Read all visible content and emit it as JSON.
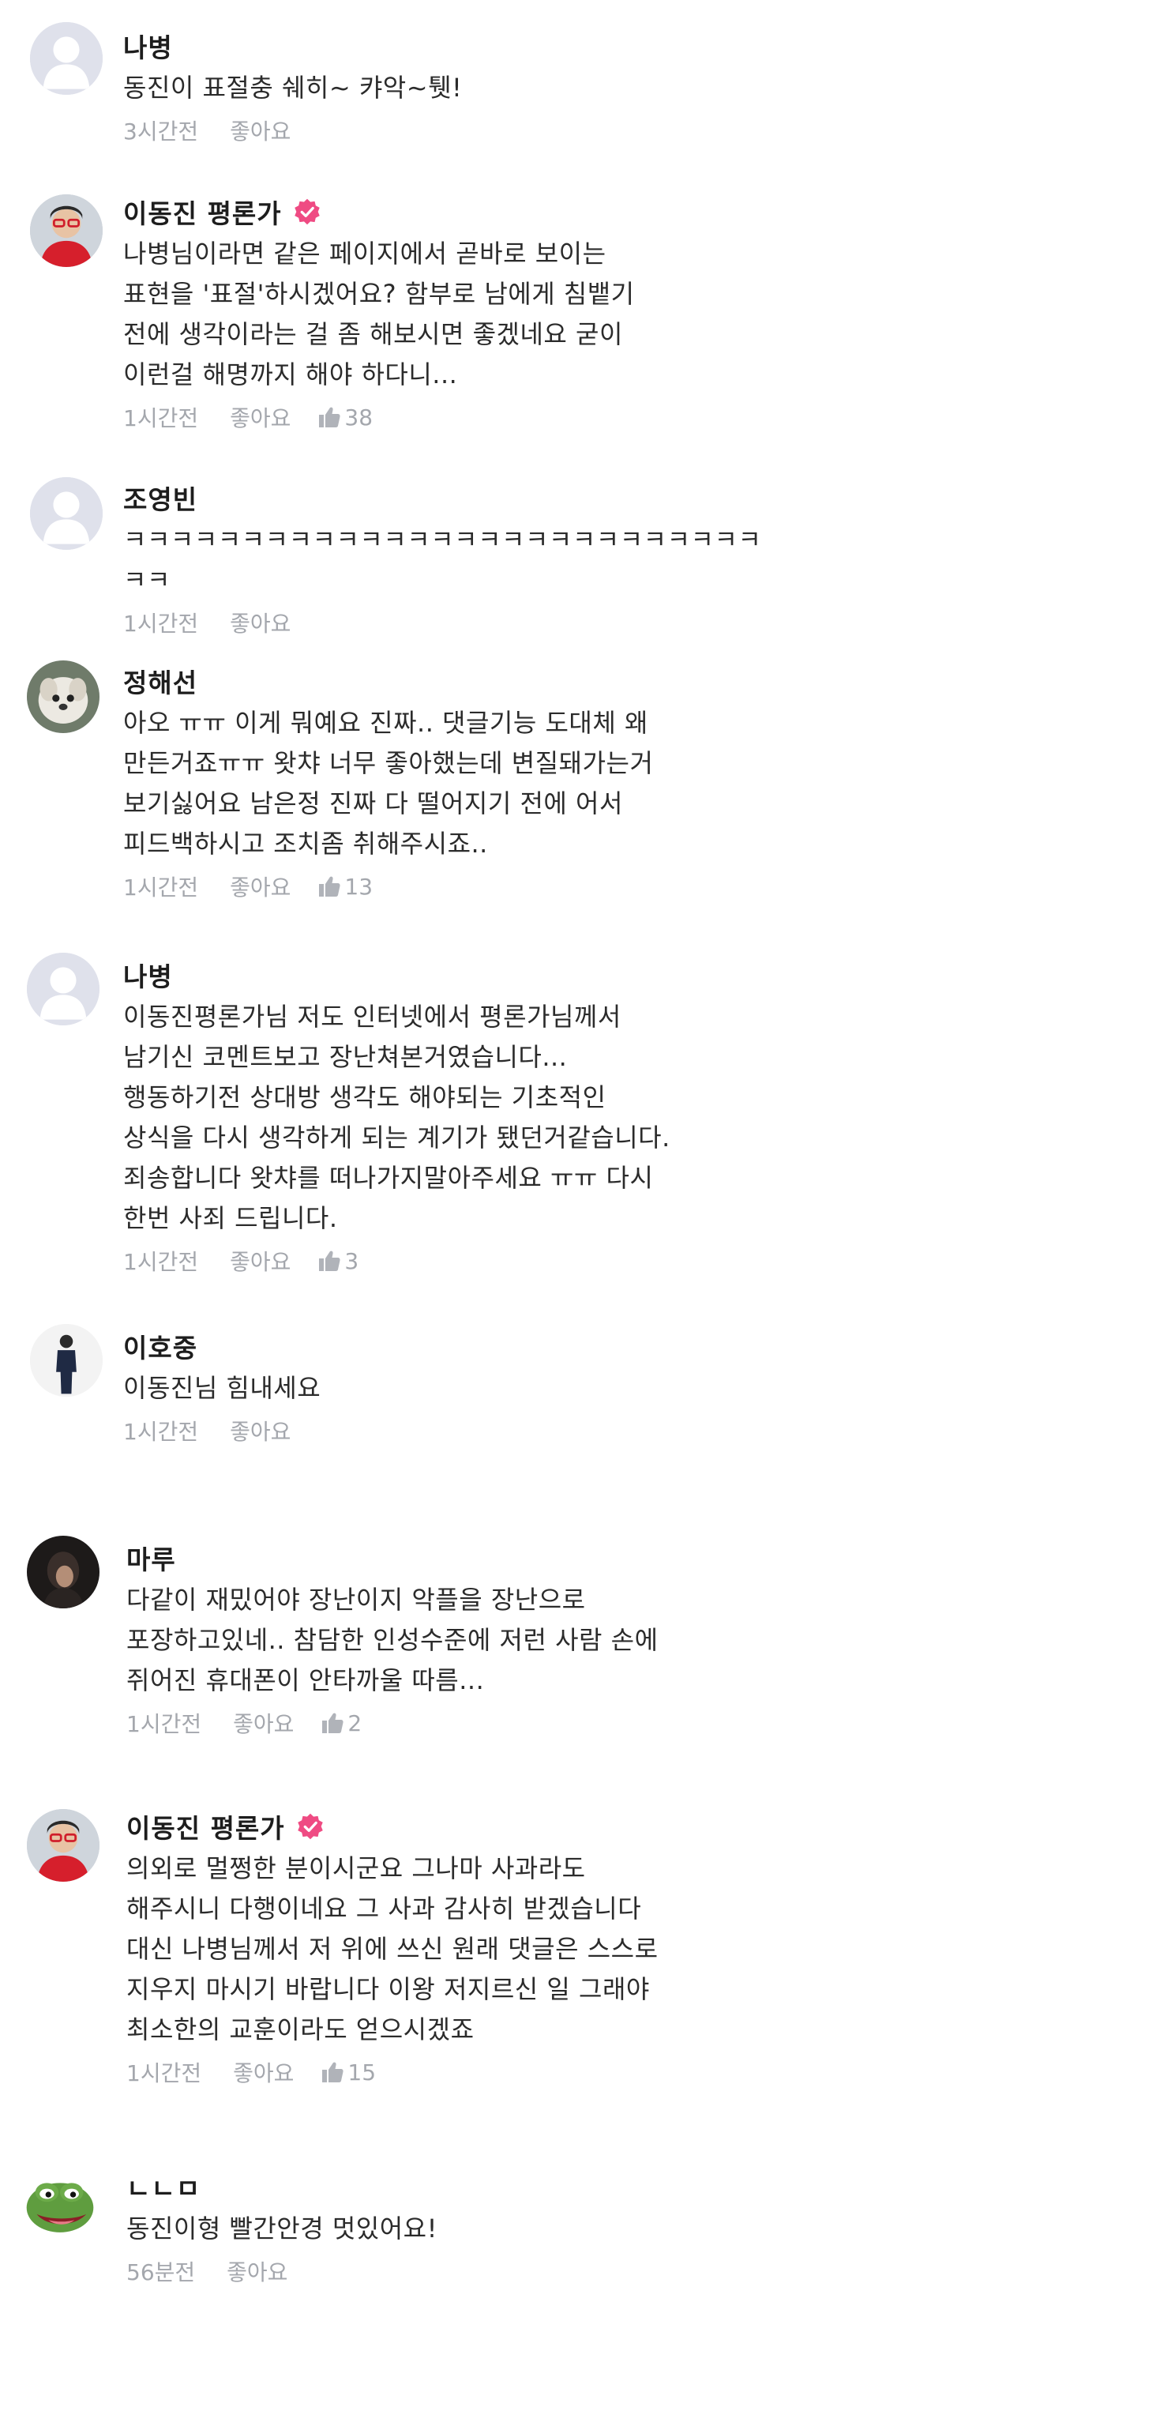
{
  "like_label": "좋아요",
  "comments": [
    {
      "author": "나병",
      "text": "동진이 표절충 쉐히~ 캬악~퉷!",
      "time": "3시간전",
      "likes": ""
    },
    {
      "author": "이동진 평론가",
      "text": "나병님이라면 같은 페이지에서 곧바로 보이는\n표현을 '표절'하시겠어요? 함부로 남에게 침뱉기\n전에 생각이라는 걸 좀 해보시면 좋겠네요 굳이\n이런걸 해명까지 해야 하다니...",
      "time": "1시간전",
      "likes": "38"
    },
    {
      "author": "조영빈",
      "text": "ㅋㅋㅋㅋㅋㅋㅋㅋㅋㅋㅋㅋㅋㅋㅋㅋㅋㅋㅋㅋㅋㅋㅋㅋㅋㅋㅋ\nㅋㅋ",
      "time": "1시간전",
      "likes": ""
    },
    {
      "author": "정해선",
      "text": "아오 ㅠㅠ 이게 뭐예요 진짜.. 댓글기능 도대체 왜\n만든거죠ㅠㅠ 왓챠 너무 좋아했는데 변질돼가는거\n보기싫어요 남은정 진짜 다 떨어지기 전에 어서\n피드백하시고 조치좀 취해주시죠..",
      "time": "1시간전",
      "likes": "13"
    },
    {
      "author": "나병",
      "text": "이동진평론가님 저도 인터넷에서 평론가님께서\n남기신 코멘트보고 장난쳐본거였습니다...\n행동하기전 상대방 생각도 해야되는 기초적인\n상식을 다시 생각하게 되는 계기가 됐던거같습니다.\n죄송합니다 왓챠를 떠나가지말아주세요 ㅠㅠ 다시\n한번 사죄 드립니다.",
      "time": "1시간전",
      "likes": "3"
    },
    {
      "author": "이호중",
      "text": "이동진님 힘내세요",
      "time": "1시간전",
      "likes": ""
    },
    {
      "author": "마루",
      "text": "다같이 재밌어야 장난이지 악플을 장난으로\n포장하고있네.. 참담한 인성수준에 저런 사람 손에\n쥐어진 휴대폰이 안타까울 따름...",
      "time": "1시간전",
      "likes": "2"
    },
    {
      "author": "이동진 평론가",
      "text": "의외로 멀쩡한 분이시군요 그나마 사과라도\n해주시니 다행이네요 그 사과 감사히 받겠습니다\n대신 나병님께서 저 위에 쓰신 원래 댓글은 스스로\n지우지 마시기 바랍니다 이왕 저지르신 일 그래야\n최소한의 교훈이라도 얻으시겠죠",
      "time": "1시간전",
      "likes": "15"
    },
    {
      "author": "ㄴㄴㅁ",
      "text": "동진이형 빨간안경 멋있어요!",
      "time": "56분전",
      "likes": ""
    }
  ]
}
